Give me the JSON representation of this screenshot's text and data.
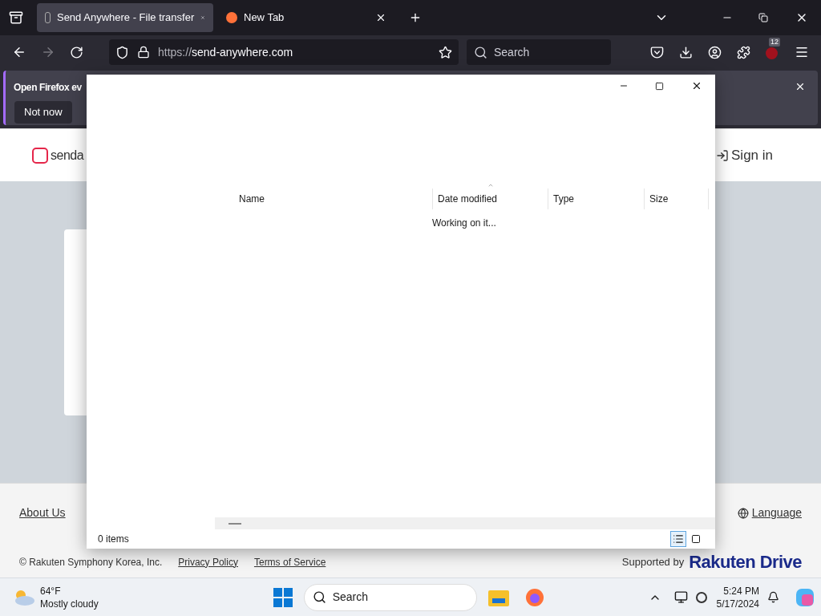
{
  "browser": {
    "tabs": [
      {
        "title": "Send Anywhere - File transfer",
        "selected": true
      },
      {
        "title": "New Tab",
        "selected": false
      }
    ],
    "url_prefix": "https://",
    "url_host": "send-anywhere.com",
    "search_placeholder": "Search",
    "badge": "12"
  },
  "notification": {
    "text": "Open Firefox ev",
    "button": "Not now"
  },
  "site": {
    "logo": "senda",
    "sign_in": "Sign in",
    "footer_links": [
      "About Us"
    ],
    "language": "Language",
    "copyright": "© Rakuten Symphony Korea, Inc.",
    "legal_links": [
      "Privacy Policy",
      "Terms of Service"
    ],
    "supported_by": "Supported by",
    "partner": "Rakuten Drive"
  },
  "dialog": {
    "columns": [
      "Name",
      "Date modified",
      "Type",
      "Size"
    ],
    "message": "Working on it...",
    "status": "0 items",
    "views": [
      {
        "kind": "details",
        "selected": true
      },
      {
        "kind": "tiles",
        "selected": false
      }
    ]
  },
  "taskbar": {
    "temperature": "64°F",
    "weather": "Mostly cloudy",
    "search": "Search",
    "time": "5:24 PM",
    "date": "5/17/2024"
  }
}
